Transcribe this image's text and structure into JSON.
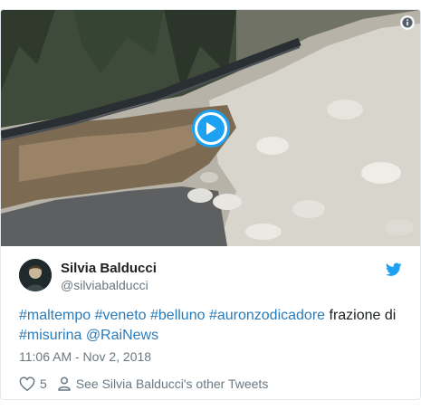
{
  "media": {
    "type": "video",
    "play_icon": "play-icon",
    "info_icon": "info-icon"
  },
  "author": {
    "name": "Silvia Balducci",
    "handle": "@silviabalducci"
  },
  "tweet": {
    "segments": [
      {
        "text": "#maltempo",
        "link": true
      },
      {
        "text": " ",
        "link": false
      },
      {
        "text": "#veneto",
        "link": true
      },
      {
        "text": " ",
        "link": false
      },
      {
        "text": "#belluno",
        "link": true
      },
      {
        "text": " ",
        "link": false
      },
      {
        "text": "#auronzodicadore",
        "link": true
      },
      {
        "text": " frazione di ",
        "link": false
      },
      {
        "text": "#misurina",
        "link": true
      },
      {
        "text": " ",
        "link": false
      },
      {
        "text": "@RaiNews",
        "link": true
      }
    ],
    "timestamp": "11:06 AM - Nov 2, 2018"
  },
  "actions": {
    "like_count": "5",
    "profile_link_label": "See Silvia Balducci's other Tweets"
  },
  "colors": {
    "link": "#2b7bb9",
    "twitter_blue": "#1da1f2",
    "muted": "#697882"
  }
}
